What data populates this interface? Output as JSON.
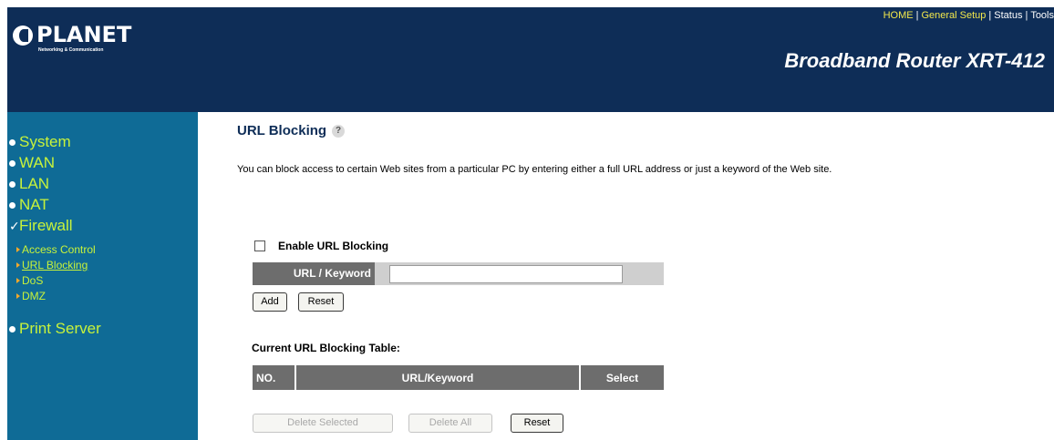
{
  "header": {
    "logo_name": "PLANET",
    "logo_tagline": "Networking & Communication",
    "nav": [
      "HOME",
      "General Setup",
      "Status",
      "Tools"
    ],
    "product_title": "Broadband Router XRT-412"
  },
  "sidebar": {
    "items": [
      {
        "label": "System"
      },
      {
        "label": "WAN"
      },
      {
        "label": "LAN"
      },
      {
        "label": "NAT"
      },
      {
        "label": "Firewall"
      },
      {
        "label": "Print Server"
      }
    ],
    "firewall_sub": [
      {
        "label": "Access Control"
      },
      {
        "label": "URL Blocking"
      },
      {
        "label": "DoS"
      },
      {
        "label": "DMZ"
      }
    ]
  },
  "main": {
    "title": "URL Blocking",
    "description": "You can block access to certain Web sites from a particular PC by entering either a full URL address or just a keyword of the Web site.",
    "enable_label": "Enable URL Blocking",
    "enable_checked": false,
    "url_label": "URL / Keyword",
    "url_value": "",
    "add_label": "Add",
    "reset_label": "Reset",
    "table_caption": "Current URL Blocking Table:",
    "table_headers": [
      "NO.",
      "URL/Keyword",
      "Select"
    ],
    "delete_selected_label": "Delete Selected",
    "delete_all_label": "Delete All",
    "bottom_reset_label": "Reset"
  },
  "colors": {
    "header_bg": "#0e2d57",
    "sidebar_bg": "#0f6b96",
    "sidebar_text": "#c7f23b",
    "nav_highlight": "#f2e84b",
    "table_header_bg": "#6d6d6d"
  }
}
